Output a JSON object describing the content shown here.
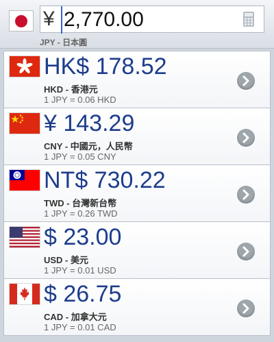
{
  "base": {
    "symbol": "¥",
    "amount": "2,770.00",
    "label": "JPY - 日本圓",
    "flag_icon": "japan-flag-icon",
    "calc_icon": "calculator-icon"
  },
  "rows": [
    {
      "value": "HK$ 178.52",
      "code": "HKD - 香港元",
      "rate": "1 JPY = 0.06 HKD",
      "flag": "hong-kong-flag-icon"
    },
    {
      "value": "¥ 143.29",
      "code": "CNY - 中國元，人民幣",
      "rate": "1 JPY = 0.05 CNY",
      "flag": "china-flag-icon"
    },
    {
      "value": "NT$ 730.22",
      "code": "TWD - 台灣新台幣",
      "rate": "1 JPY = 0.26 TWD",
      "flag": "taiwan-flag-icon"
    },
    {
      "value": "$ 23.00",
      "code": "USD - 美元",
      "rate": "1 JPY = 0.01 USD",
      "flag": "usa-flag-icon"
    },
    {
      "value": "$ 26.75",
      "code": "CAD - 加拿大元",
      "rate": "1 JPY = 0.01 CAD",
      "flag": "canada-flag-icon"
    }
  ],
  "colors": {
    "value_text": "#1d3d8c",
    "background": "#cfd5dc",
    "chevron": "#9ea6ad"
  }
}
